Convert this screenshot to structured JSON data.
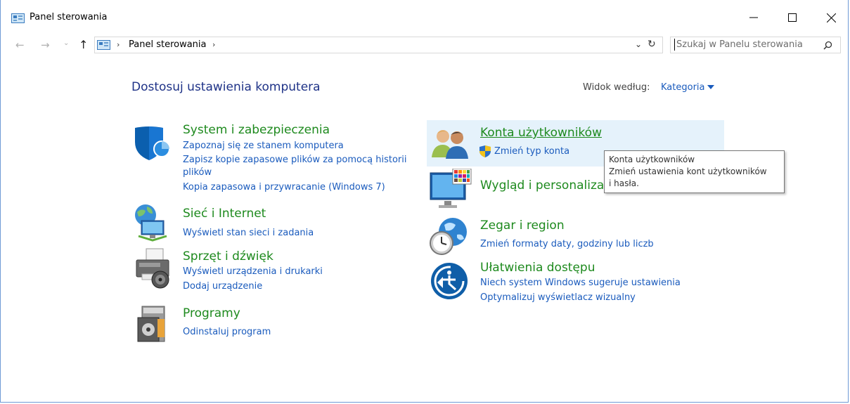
{
  "window": {
    "title": "Panel sterowania",
    "colors": {
      "heading": "#1e3287",
      "category": "#1e8a1e",
      "link": "#1a5bbd",
      "hover": "#e5f2fb"
    }
  },
  "address": {
    "crumb": "Panel sterowania",
    "search_placeholder": "Szukaj w Panelu sterowania"
  },
  "main": {
    "heading": "Dostosuj ustawienia komputera",
    "view_label": "Widok według:",
    "view_value": "Kategoria"
  },
  "categories": [
    {
      "title": "System i zabezpieczenia",
      "icon": "shield-icon",
      "links": [
        "Zapoznaj się ze stanem komputera",
        "Zapisz kopie zapasowe plików za pomocą historii",
        "plików",
        "Kopia zapasowa i przywracanie (Windows 7)"
      ]
    },
    {
      "title": "Sieć i Internet",
      "icon": "network-icon",
      "links": [
        "Wyświetl stan sieci i zadania"
      ]
    },
    {
      "title": "Sprzęt i dźwięk",
      "icon": "printer-icon",
      "links": [
        "Wyświetl urządzenia i drukarki",
        "Dodaj urządzenie"
      ]
    },
    {
      "title": "Programy",
      "icon": "programs-icon",
      "links": [
        "Odinstaluj program"
      ]
    },
    {
      "title": "Konta użytkowników",
      "icon": "users-icon",
      "links": [
        "Zmień typ konta"
      ]
    },
    {
      "title": "Wygląd i personaliza",
      "icon": "appearance-icon",
      "links": []
    },
    {
      "title": "Zegar i region",
      "icon": "clock-globe-icon",
      "links": [
        "Zmień formaty daty, godziny lub liczb"
      ]
    },
    {
      "title": "Ułatwienia dostępu",
      "icon": "accessibility-icon",
      "links": [
        "Niech system Windows sugeruje ustawienia",
        "Optymalizuj wyświetlacz wizualny"
      ]
    }
  ],
  "tooltip": {
    "line1": "Konta użytkowników",
    "line2": "Zmień ustawienia kont użytkowników",
    "line3": "i hasła."
  }
}
